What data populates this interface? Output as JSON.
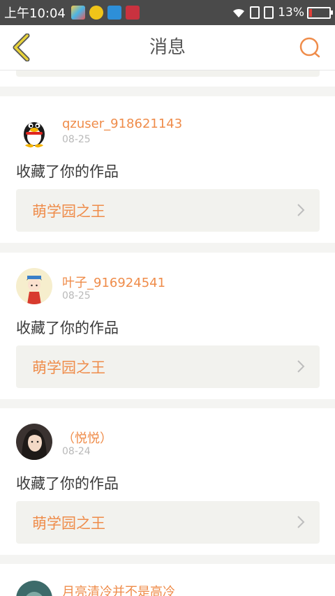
{
  "status_bar": {
    "time": "上午10:04",
    "battery": "13%",
    "battery_level": 0.13
  },
  "header": {
    "title": "消息"
  },
  "notifications": [
    {
      "username": "qzuser_918621143",
      "date": "08-25",
      "action": "收藏了你的作品",
      "work_title": "萌学园之王"
    },
    {
      "username": "叶子_916924541",
      "date": "08-25",
      "action": "收藏了你的作品",
      "work_title": "萌学园之王"
    },
    {
      "username": "（悦悦）",
      "date": "08-24",
      "action": "收藏了你的作品",
      "work_title": "萌学园之王"
    }
  ],
  "partial_notification": {
    "username": "月亮清冷并不是高冷"
  },
  "colors": {
    "accent": "#ef8c4a",
    "back_arrow": "#e8d23a",
    "status_bar": "#4a4a4a"
  },
  "icons": [
    "back-arrow-icon",
    "search-icon",
    "chevron-right-icon",
    "wifi-icon",
    "sim-icon",
    "battery-icon"
  ]
}
